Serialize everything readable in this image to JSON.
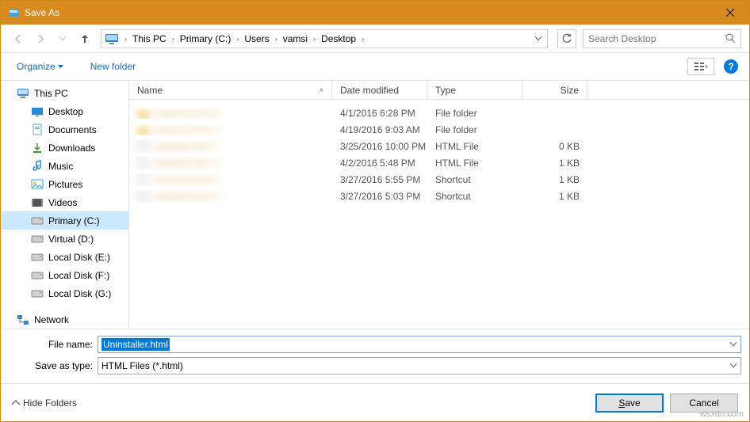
{
  "title": "Save As",
  "breadcrumb": [
    "This PC",
    "Primary (C:)",
    "Users",
    "vamsi",
    "Desktop"
  ],
  "search_placeholder": "Search Desktop",
  "toolbar": {
    "organize": "Organize",
    "new_folder": "New folder"
  },
  "tree": {
    "root": "This PC",
    "children": [
      "Desktop",
      "Documents",
      "Downloads",
      "Music",
      "Pictures",
      "Videos",
      "Primary (C:)",
      "Virtual (D:)",
      "Local Disk (E:)",
      "Local Disk (F:)",
      "Local Disk (G:)"
    ],
    "network": "Network",
    "selected": "Primary (C:)"
  },
  "columns": {
    "name": "Name",
    "date": "Date modified",
    "type": "Type",
    "size": "Size"
  },
  "rows": [
    {
      "name": "",
      "date": "4/1/2016 6:28 PM",
      "type": "File folder",
      "size": ""
    },
    {
      "name": "",
      "date": "4/19/2016 9:03 AM",
      "type": "File folder",
      "size": ""
    },
    {
      "name": "",
      "date": "3/25/2016 10:00 PM",
      "type": "HTML File",
      "size": "0 KB"
    },
    {
      "name": "",
      "date": "4/2/2016 5:48 PM",
      "type": "HTML File",
      "size": "1 KB"
    },
    {
      "name": "",
      "date": "3/27/2016 5:55 PM",
      "type": "Shortcut",
      "size": "1 KB"
    },
    {
      "name": "",
      "date": "3/27/2016 5:03 PM",
      "type": "Shortcut",
      "size": "1 KB"
    }
  ],
  "form": {
    "filename_label": "File name:",
    "filename_value": "Uninstaller.html",
    "type_label": "Save as type:",
    "type_value": "HTML Files (*.html)"
  },
  "actions": {
    "hide": "Hide Folders",
    "save": "Save",
    "cancel": "Cancel"
  },
  "watermark": "wsxdn.com"
}
